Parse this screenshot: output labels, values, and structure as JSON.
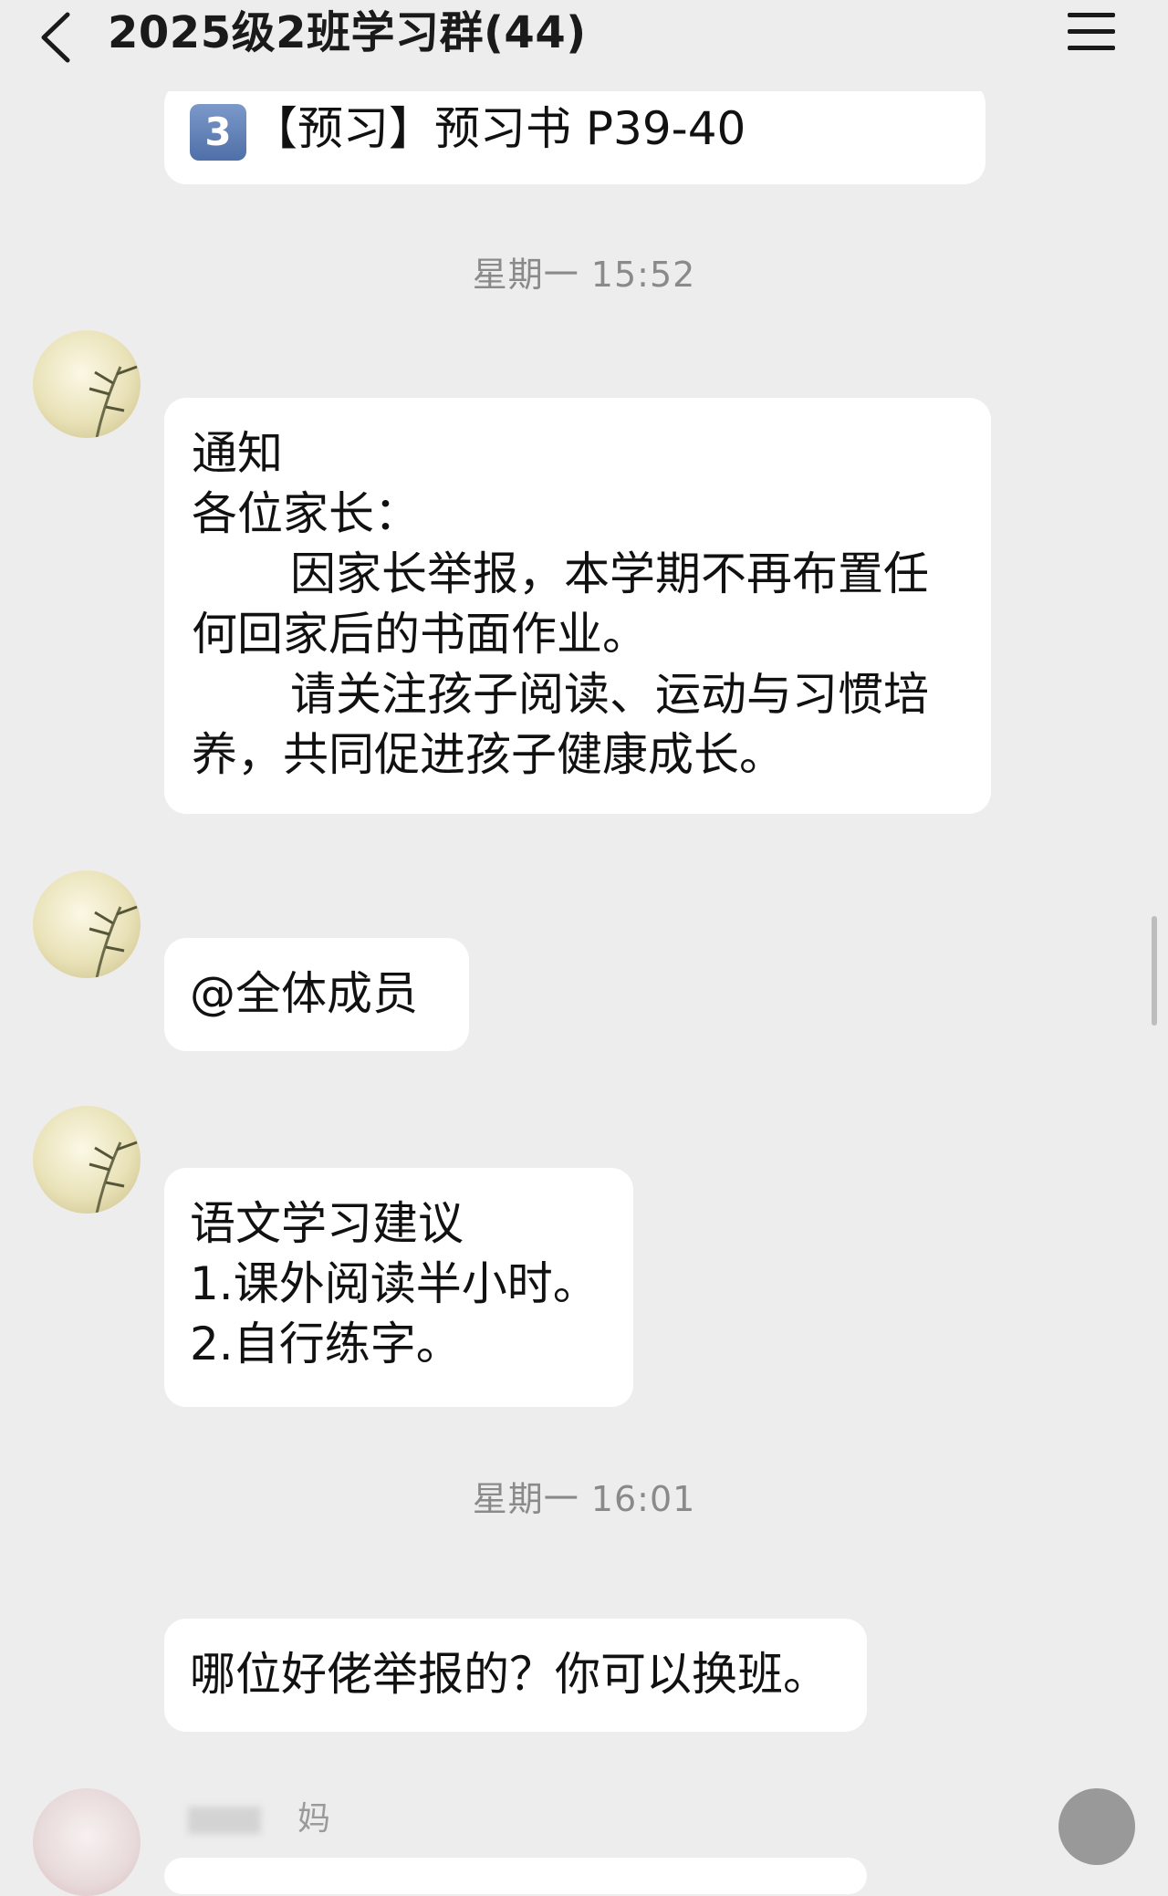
{
  "header": {
    "title": "2025级2班学习群(44)"
  },
  "messages": {
    "m1": {
      "badge": "3",
      "text": "【预习】预习书 P39-40"
    },
    "ts1": "星期一 15:52",
    "m2": {
      "lines": [
        "通知",
        "各位家长：",
        "因家长举报，本学期不再布置任",
        "何回家后的书面作业。",
        "请关注孩子阅读、运动与习惯培",
        "养，共同促进孩子健康成长。"
      ]
    },
    "m3": {
      "text": "@全体成员"
    },
    "m4": {
      "lines": [
        "语文学习建议",
        "1.课外阅读半小时。",
        "2.自行练字。"
      ]
    },
    "ts2": "星期一 16:01",
    "m5": {
      "text": "哪位好佬举报的？你可以换班。"
    },
    "sender_suffix": "妈"
  },
  "colors": {
    "background": "#ededed",
    "bubble": "#ffffff",
    "timestamp": "#8a8a8a"
  },
  "icons": {
    "back": "chevron-left-icon",
    "menu": "hamburger-menu-icon"
  }
}
